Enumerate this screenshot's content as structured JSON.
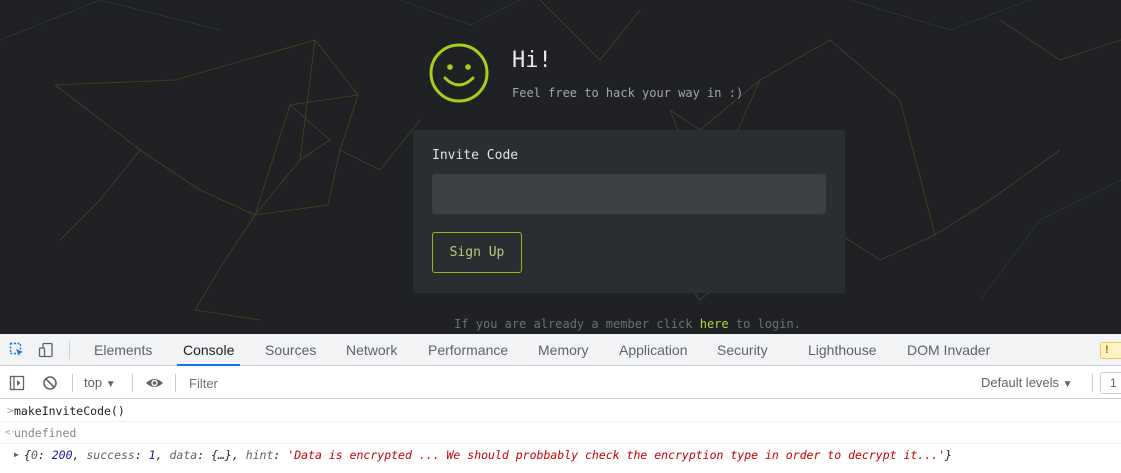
{
  "page": {
    "greeting_title": "Hi!",
    "greeting_subtitle": "Feel free to hack your way in :)",
    "form": {
      "label": "Invite Code",
      "input_value": "",
      "submit_label": "Sign Up"
    },
    "login_prefix": "If you are already a member click ",
    "login_link": "here",
    "login_suffix": " to login.",
    "accent_color": "#9ab51a"
  },
  "devtools": {
    "tabs": [
      "Elements",
      "Console",
      "Sources",
      "Network",
      "Performance",
      "Memory",
      "Application",
      "Security",
      "Lighthouse",
      "DOM Invader"
    ],
    "active_tab": "Console",
    "warning_badge": "!",
    "toolbar": {
      "context": "top",
      "context_arrow": "▼",
      "filter_placeholder": "Filter",
      "levels": "Default levels",
      "levels_arrow": "▼",
      "issues_count": "1"
    },
    "console": {
      "input_prompt": ">",
      "command": "makeInviteCode()",
      "return_prompt": "<·",
      "return_value": "undefined",
      "expand_icon": "▶",
      "result": {
        "open": "{",
        "k0": "0",
        "v0": "200",
        "k1": "success",
        "v1": "1",
        "k2": "data",
        "v2": "{…}",
        "k3": "hint",
        "v3": "'Data is encrypted ... We should probbably check the encryption type in order to decrypt it...'",
        "close": "}"
      }
    }
  }
}
